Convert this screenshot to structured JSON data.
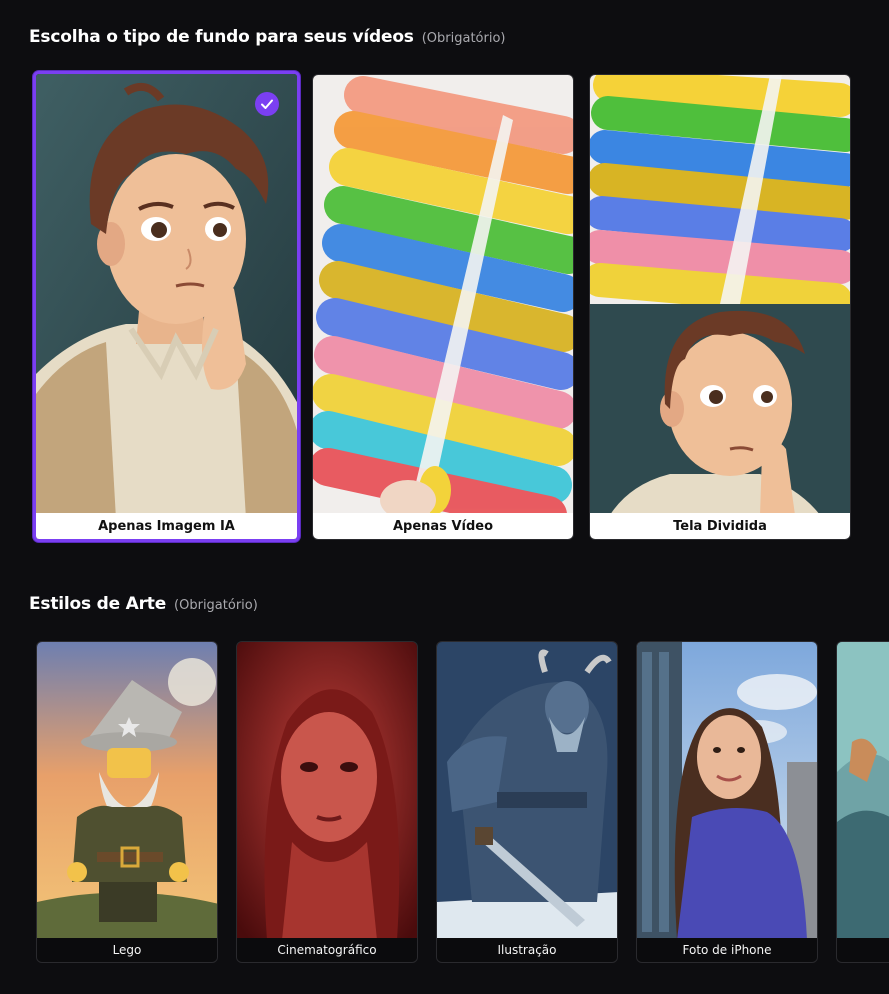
{
  "background_section": {
    "title": "Escolha o tipo de fundo para seus vídeos",
    "required": "(Obrigatório)",
    "options": [
      {
        "label": "Apenas Imagem IA",
        "selected": true
      },
      {
        "label": "Apenas Vídeo",
        "selected": false
      },
      {
        "label": "Tela Dividida",
        "selected": false
      }
    ]
  },
  "art_section": {
    "title": "Estilos de Arte",
    "required": "(Obrigatório)",
    "styles": [
      {
        "label": "Lego"
      },
      {
        "label": "Cinematográfico"
      },
      {
        "label": "Ilustração"
      },
      {
        "label": "Foto de iPhone"
      }
    ]
  },
  "colors": {
    "accent": "#7b3ff2",
    "background": "#0d0d10",
    "caption_light": "#ffffff",
    "caption_dark": "#0b0b0d"
  },
  "icons": {
    "selected_badge": "check-icon"
  }
}
